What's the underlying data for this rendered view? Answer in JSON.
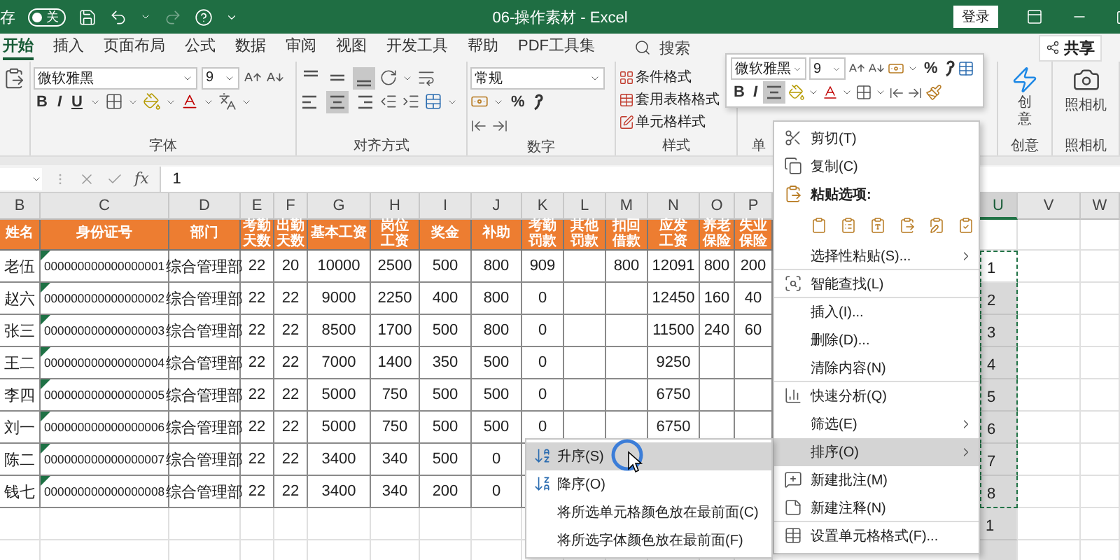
{
  "title_bar": {
    "autosave_label": "存",
    "autosave_state": "关",
    "autosave_on": false,
    "redo_disabled": true,
    "title": "06-操作素材 - Excel",
    "sign_in": "登录"
  },
  "tabs": [
    {
      "label": "开始",
      "selected": true
    },
    {
      "label": "插入",
      "selected": false
    },
    {
      "label": "页面布局",
      "selected": false
    },
    {
      "label": "公式",
      "selected": false
    },
    {
      "label": "数据",
      "selected": false
    },
    {
      "label": "审阅",
      "selected": false
    },
    {
      "label": "视图",
      "selected": false
    },
    {
      "label": "开发工具",
      "selected": false
    },
    {
      "label": "帮助",
      "selected": false
    },
    {
      "label": "PDF工具集",
      "selected": false
    }
  ],
  "search": {
    "label": "搜索"
  },
  "share": "共享",
  "ribbon": {
    "groups": [
      {
        "kind": "font",
        "label": "字体",
        "font": "微软雅黑",
        "size": "9",
        "bold": "B",
        "italic": "I",
        "underline": "U"
      },
      {
        "kind": "alignment",
        "label": "对齐方式",
        "valign": [
          {
            "selected": false
          },
          {
            "selected": false
          },
          {
            "selected": true
          }
        ],
        "halign": [
          {
            "selected": false
          },
          {
            "selected": true
          },
          {
            "selected": false
          }
        ]
      },
      {
        "kind": "number",
        "label": "数字",
        "format": "常规",
        "percent": "%"
      },
      {
        "kind": "styles",
        "label": "样式",
        "items": [
          "条件格式",
          "套用表格格式",
          "单元格样式"
        ]
      },
      {
        "kind": "cells",
        "label": "单"
      },
      {
        "kind": "creative",
        "label": "创意",
        "button": "创意"
      },
      {
        "kind": "camera",
        "label": "照相机",
        "button": "照相机"
      }
    ]
  },
  "formula_bar": {
    "function_label": "fx",
    "value": "1"
  },
  "sheet": {
    "columns": [
      {
        "label": "B",
        "selected": false
      },
      {
        "label": "C",
        "selected": false
      },
      {
        "label": "D",
        "selected": false
      },
      {
        "label": "E",
        "selected": false
      },
      {
        "label": "F",
        "selected": false
      },
      {
        "label": "G",
        "selected": false
      },
      {
        "label": "H",
        "selected": false
      },
      {
        "label": "I",
        "selected": false
      },
      {
        "label": "J",
        "selected": false
      },
      {
        "label": "K",
        "selected": false
      },
      {
        "label": "L",
        "selected": false
      },
      {
        "label": "M",
        "selected": false
      },
      {
        "label": "N",
        "selected": false
      },
      {
        "label": "O",
        "selected": false
      },
      {
        "label": "P",
        "selected": false
      },
      {
        "label": "U",
        "selected": true
      },
      {
        "label": "V",
        "selected": false
      },
      {
        "label": "W",
        "selected": false
      }
    ],
    "header": [
      "姓名",
      "身份证号",
      "部门",
      "考勤天数",
      "出勤天数",
      "基本工资",
      "岗位工资",
      "奖金",
      "补助",
      "考勤罚款",
      "其他罚款",
      "扣回借款",
      "应发工资",
      "养老保险",
      "失业保险"
    ],
    "rows": [
      {
        "warning": true,
        "cells": [
          "老伍",
          "000000000000000001",
          "综合管理部",
          "22",
          "20",
          "10000",
          "2500",
          "500",
          "800",
          "909",
          null,
          "800",
          "12091",
          "800",
          "200"
        ],
        "u": {
          "value": "1",
          "selected": false,
          "copied": true
        }
      },
      {
        "warning": true,
        "cells": [
          "赵六",
          "000000000000000002",
          "综合管理部",
          "22",
          "22",
          "9000",
          "2250",
          "400",
          "800",
          "0",
          null,
          null,
          "12450",
          "160",
          "40"
        ],
        "u": {
          "value": "2",
          "selected": true,
          "copied": true
        }
      },
      {
        "warning": true,
        "cells": [
          "张三",
          "000000000000000003",
          "综合管理部",
          "22",
          "22",
          "8500",
          "1700",
          "500",
          "800",
          "0",
          null,
          null,
          "11500",
          "240",
          "60"
        ],
        "u": {
          "value": "3",
          "selected": true,
          "copied": true
        }
      },
      {
        "warning": true,
        "cells": [
          "王二",
          "000000000000000004",
          "综合管理部",
          "22",
          "22",
          "7000",
          "1400",
          "350",
          "500",
          "0",
          null,
          null,
          "9250",
          null,
          null
        ],
        "u": {
          "value": "4",
          "selected": true,
          "copied": true
        }
      },
      {
        "warning": true,
        "cells": [
          "李四",
          "000000000000000005",
          "综合管理部",
          "22",
          "22",
          "5000",
          "750",
          "500",
          "500",
          "0",
          null,
          null,
          "6750",
          null,
          null
        ],
        "u": {
          "value": "5",
          "selected": true,
          "copied": true
        }
      },
      {
        "warning": true,
        "cells": [
          "刘一",
          "000000000000000006",
          "综合管理部",
          "22",
          "22",
          "5000",
          "750",
          "500",
          "500",
          "0",
          null,
          null,
          "6750",
          null,
          null
        ],
        "u": {
          "value": "6",
          "selected": true,
          "copied": true
        }
      },
      {
        "warning": true,
        "cells": [
          "陈二",
          "000000000000000007",
          "综合管理部",
          "22",
          "22",
          "3400",
          "340",
          "500",
          "0"
        ],
        "u": {
          "value": "7",
          "selected": true,
          "copied": true
        }
      },
      {
        "warning": true,
        "cells": [
          "钱七",
          "000000000000000008",
          "综合管理部",
          "22",
          "22",
          "3400",
          "340",
          "200",
          "0"
        ],
        "u": {
          "value": "8",
          "selected": true,
          "copied": true
        }
      },
      {
        "u": {
          "value": "1",
          "selected": true,
          "copied": false
        }
      },
      {
        "u": {
          "selected": true,
          "copied": false
        }
      }
    ]
  },
  "mini_toolbar": {
    "font": "微软雅黑",
    "size": "9",
    "percent": "%",
    "bold": "B",
    "italic": "I",
    "align_selected": true
  },
  "context_menu": {
    "items": [
      {
        "kind": "command",
        "label": "剪切(T)",
        "submenu": false,
        "selected": false,
        "divider_after": false
      },
      {
        "kind": "command",
        "label": "复制(C)",
        "submenu": false,
        "selected": false,
        "divider_after": false
      },
      {
        "kind": "heading",
        "label": "粘贴选项:",
        "submenu": false,
        "selected": false,
        "divider_after": false
      },
      {
        "kind": "paste_options",
        "submenu": false,
        "selected": false,
        "divider_after": false
      },
      {
        "kind": "command",
        "label": "选择性粘贴(S)...",
        "submenu": true,
        "selected": false,
        "divider_after": true
      },
      {
        "kind": "command",
        "label": "智能查找(L)",
        "submenu": false,
        "selected": false,
        "divider_after": true
      },
      {
        "kind": "command",
        "label": "插入(I)...",
        "submenu": false,
        "selected": false,
        "divider_after": false
      },
      {
        "kind": "command",
        "label": "删除(D)...",
        "submenu": false,
        "selected": false,
        "divider_after": false
      },
      {
        "kind": "command",
        "label": "清除内容(N)",
        "submenu": false,
        "selected": false,
        "divider_after": true
      },
      {
        "kind": "command",
        "label": "快速分析(Q)",
        "submenu": false,
        "selected": false,
        "divider_after": false
      },
      {
        "kind": "command",
        "label": "筛选(E)",
        "submenu": true,
        "selected": false,
        "divider_after": false
      },
      {
        "kind": "command",
        "label": "排序(O)",
        "submenu": true,
        "selected": true,
        "divider_after": false
      },
      {
        "kind": "command",
        "label": "新建批注(M)",
        "submenu": false,
        "selected": false,
        "divider_after": false
      },
      {
        "kind": "command",
        "label": "新建注释(N)",
        "submenu": false,
        "selected": false,
        "divider_after": true
      },
      {
        "kind": "command",
        "label": "设置单元格格式(F)...",
        "submenu": false,
        "selected": false,
        "divider_after": false
      }
    ]
  },
  "sort_submenu": {
    "items": [
      {
        "label": "升序(S)",
        "selected": true
      },
      {
        "label": "降序(O)",
        "selected": false
      },
      {
        "label": "将所选单元格颜色放在最前面(C)",
        "selected": false
      },
      {
        "label": "将所选字体颜色放在最前面(F)",
        "selected": false
      }
    ]
  }
}
